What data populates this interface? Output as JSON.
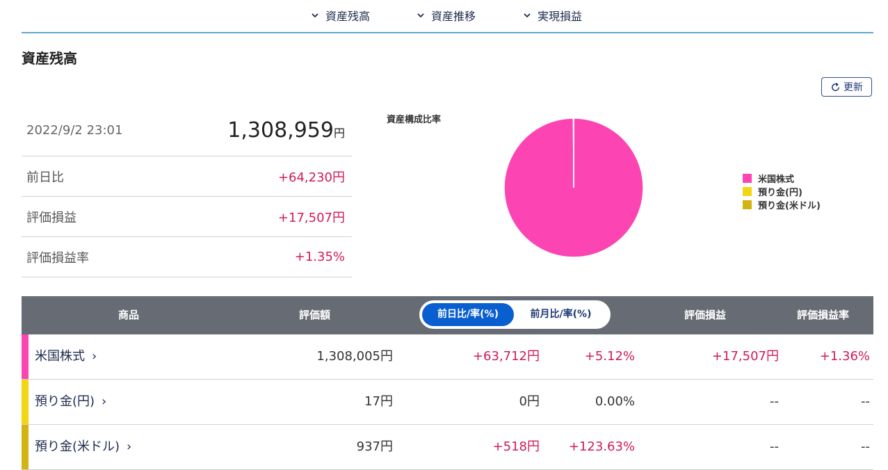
{
  "nav": {
    "items": [
      {
        "label": "資産残高"
      },
      {
        "label": "資産推移"
      },
      {
        "label": "実現損益"
      }
    ]
  },
  "page": {
    "title": "資産残高"
  },
  "refresh": {
    "label": "更新"
  },
  "summary": {
    "datetime": "2022/9/2 23:01",
    "total": "1,308,959",
    "total_unit": "円",
    "rows": [
      {
        "label": "前日比",
        "value": "+64,230円"
      },
      {
        "label": "評価損益",
        "value": "+17,507円"
      },
      {
        "label": "評価損益率",
        "value": "+1.35%"
      }
    ]
  },
  "chart_data": {
    "type": "pie",
    "title": "資産構成比率",
    "categories": [
      "米国株式",
      "預り金(円)",
      "預り金(米ドル)"
    ],
    "values": [
      1308005,
      17,
      937
    ],
    "colors": [
      "#fc44b3",
      "#f2d614",
      "#d4b412"
    ],
    "legend_position": "right"
  },
  "table": {
    "headers": {
      "product": "商品",
      "value": "評価額",
      "toggle_active": "前日比/率(%)",
      "toggle_inactive": "前月比/率(%)",
      "pl": "評価損益",
      "pl_rate": "評価損益率"
    },
    "rows": [
      {
        "name": "米国株式",
        "color": "#fc44b3",
        "value": "1,308,005円",
        "change": "+63,712円",
        "change_rate": "+5.12%",
        "pl": "+17,507円",
        "pl_rate": "+1.36%"
      },
      {
        "name": "預り金(円)",
        "color": "#f2d614",
        "value": "17円",
        "change": "0円",
        "change_rate": "0.00%",
        "pl": "--",
        "pl_rate": "--"
      },
      {
        "name": "預り金(米ドル)",
        "color": "#d4b412",
        "value": "937円",
        "change": "+518円",
        "change_rate": "+123.63%",
        "pl": "--",
        "pl_rate": "--"
      }
    ]
  }
}
